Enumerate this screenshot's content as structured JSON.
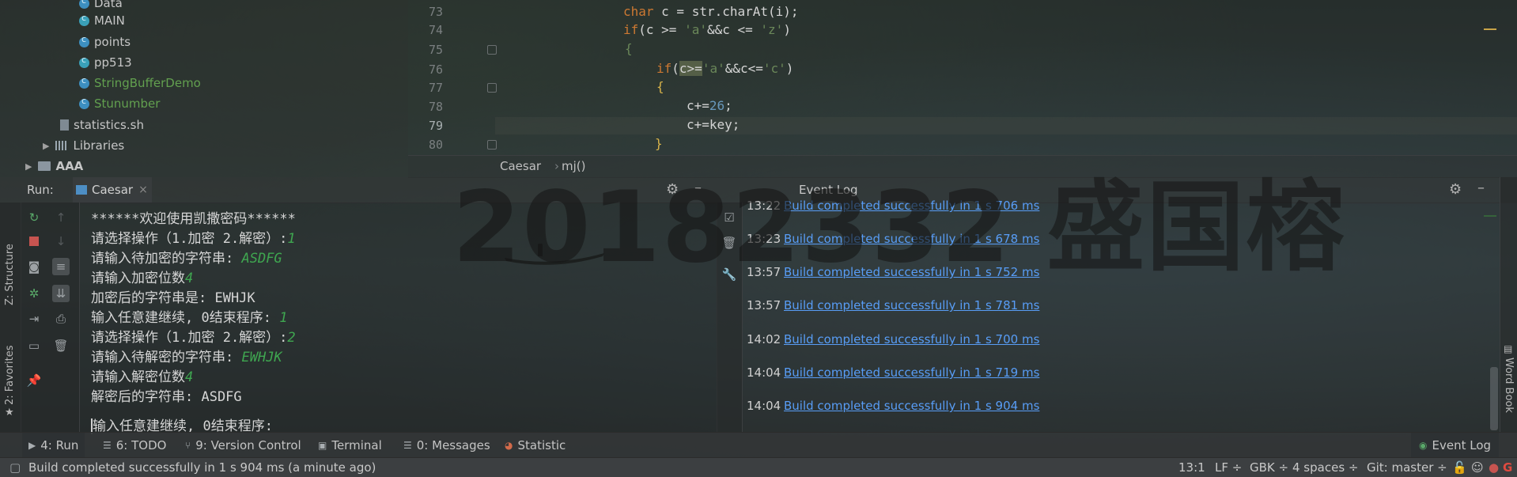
{
  "project_tree": {
    "items": [
      {
        "label": "Data",
        "type": "class"
      },
      {
        "label": "MAIN",
        "type": "class-main"
      },
      {
        "label": "points",
        "type": "class"
      },
      {
        "label": "pp513",
        "type": "class-main"
      },
      {
        "label": "StringBufferDemo",
        "type": "class-green"
      },
      {
        "label": "Stunumber",
        "type": "class-green"
      },
      {
        "label": "statistics.sh",
        "type": "file"
      },
      {
        "label": "Libraries",
        "type": "library"
      },
      {
        "label": "AAA",
        "type": "folder"
      }
    ]
  },
  "editor": {
    "line_numbers": [
      "73",
      "74",
      "75",
      "76",
      "77",
      "78",
      "79",
      "80"
    ],
    "current_line": "79",
    "code": {
      "l73_kw": "char",
      "l73_rest": " c = str.charAt(i);",
      "l74_kw": "if",
      "l74_a": "(c >= ",
      "l74_s1": "'a'",
      "l74_b": "&&c <= ",
      "l74_s2": "'z'",
      "l74_c": ")",
      "l75": "{",
      "l76_kw": "if",
      "l76_a": "(",
      "l76_hl": "c>=",
      "l76_s1": "'a'",
      "l76_b": "&&c<=",
      "l76_s2": "'c'",
      "l76_c": ")",
      "l77": "{",
      "l78_a": "c+=",
      "l78_num": "26",
      "l78_b": ";",
      "l79": "c+=key;",
      "l80": "}"
    },
    "breadcrumb": [
      "Caesar",
      "mj()"
    ]
  },
  "run_panel": {
    "label": "Run:",
    "tab": "Caesar",
    "tab_close": "×",
    "console": [
      {
        "text": "******欢迎使用凯撒密码******",
        "input": ""
      },
      {
        "text": "请选择操作（1.加密 2.解密）:",
        "input": "1"
      },
      {
        "text": "请输入待加密的字符串: ",
        "input": "ASDFG"
      },
      {
        "text": "请输入加密位数",
        "input": "4"
      },
      {
        "text": "加密后的字符串是: EWHJK",
        "input": ""
      },
      {
        "text": "输入任意建继续, 0结束程序: ",
        "input": "1"
      },
      {
        "text": "请选择操作（1.加密 2.解密）:",
        "input": "2"
      },
      {
        "text": "请输入待解密的字符串: ",
        "input": "EWHJK"
      },
      {
        "text": "请输入解密位数",
        "input": "4"
      },
      {
        "text": "解密后的字符串: ASDFG",
        "input": ""
      },
      {
        "text": "",
        "input": ""
      },
      {
        "text": "输入任意建继续, 0结束程序: ",
        "input": ""
      }
    ]
  },
  "event_log": {
    "title": "Event Log",
    "entries": [
      {
        "time": "13:22",
        "message": "Build completed successfully in 1 s 706 ms"
      },
      {
        "time": "13:23",
        "message": "Build completed successfully in 1 s 678 ms"
      },
      {
        "time": "13:57",
        "message": "Build completed successfully in 1 s 752 ms"
      },
      {
        "time": "13:57",
        "message": "Build completed successfully in 1 s 781 ms"
      },
      {
        "time": "14:02",
        "message": "Build completed successfully in 1 s 700 ms"
      },
      {
        "time": "14:04",
        "message": "Build completed successfully in 1 s 719 ms"
      },
      {
        "time": "14:04",
        "message": "Build completed successfully in 1 s 904 ms"
      }
    ]
  },
  "side_tabs": {
    "structure": "Z: Structure",
    "favorites": "2: Favorites",
    "word_book": "Word Book"
  },
  "tool_tabs": {
    "run": "4: Run",
    "todo": "6: TODO",
    "vcs": "9: Version Control",
    "terminal": "Terminal",
    "messages": "0: Messages",
    "statistic": "Statistic",
    "event_log": "Event Log"
  },
  "status_bar": {
    "message": "Build completed successfully in 1 s 904 ms (a minute ago)",
    "position": "13:1",
    "line_sep": "LF ÷",
    "encoding": "GBK ÷",
    "indent": "4 spaces ÷",
    "git": "Git: master ÷"
  },
  "watermark": "20182332 盛国榕",
  "colors": {
    "link": "#589df6",
    "console_input": "#3fa650",
    "keyword": "#cc7832",
    "string": "#6a8759"
  },
  "icons": [
    "run-icon",
    "stop-icon",
    "camera-icon",
    "gear-icon",
    "trash-icon",
    "print-icon",
    "pin-icon",
    "wrench-icon",
    "lock-icon",
    "git-icon"
  ]
}
